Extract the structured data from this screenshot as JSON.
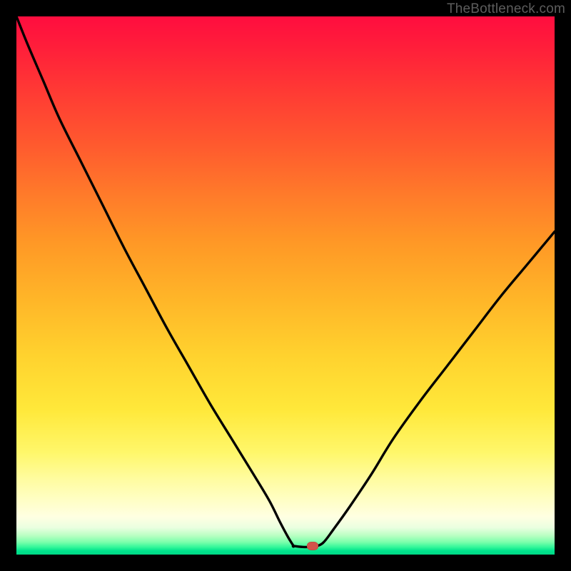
{
  "watermark": "TheBottleneck.com",
  "colors": {
    "frame": "#000000",
    "curve": "#000000",
    "marker": "#d2534a",
    "gradient_top": "#ff0d3f",
    "gradient_bottom": "#00d886"
  },
  "chart_data": {
    "type": "line",
    "title": "",
    "xlabel": "",
    "ylabel": "",
    "xlim": [
      0,
      100
    ],
    "ylim": [
      0,
      100
    ],
    "grid": false,
    "legend": false,
    "note": "Axes unlabeled in source image; values are read as percent of plot width (x) and height from bottom (y).",
    "series": [
      {
        "name": "left-branch",
        "x": [
          0,
          2,
          5,
          8,
          12,
          16,
          20,
          24,
          28,
          32,
          36,
          40,
          44,
          47,
          49,
          50.5,
          51.5
        ],
        "y": [
          100,
          95,
          88,
          81,
          73,
          65,
          57,
          49.5,
          42,
          35,
          28,
          21.5,
          15,
          10,
          6,
          3.2,
          1.6
        ]
      },
      {
        "name": "valley-flat",
        "x": [
          51.5,
          53.5,
          55.5
        ],
        "y": [
          1.6,
          1.4,
          1.5
        ]
      },
      {
        "name": "right-branch",
        "x": [
          55.5,
          57,
          59,
          62,
          66,
          70,
          75,
          80,
          85,
          90,
          95,
          100
        ],
        "y": [
          1.5,
          2.2,
          4.8,
          9,
          15,
          21.5,
          28.5,
          35,
          41.5,
          48,
          54,
          60
        ]
      }
    ],
    "marker": {
      "x": 55,
      "y": 1.6
    },
    "background_gradient_stops": [
      {
        "pos": 0.0,
        "color": "#ff0d3f"
      },
      {
        "pos": 0.24,
        "color": "#ff5a2e"
      },
      {
        "pos": 0.52,
        "color": "#ffb428"
      },
      {
        "pos": 0.73,
        "color": "#ffe83a"
      },
      {
        "pos": 0.9,
        "color": "#fffec6"
      },
      {
        "pos": 0.97,
        "color": "#7affab"
      },
      {
        "pos": 1.0,
        "color": "#00d886"
      }
    ]
  }
}
